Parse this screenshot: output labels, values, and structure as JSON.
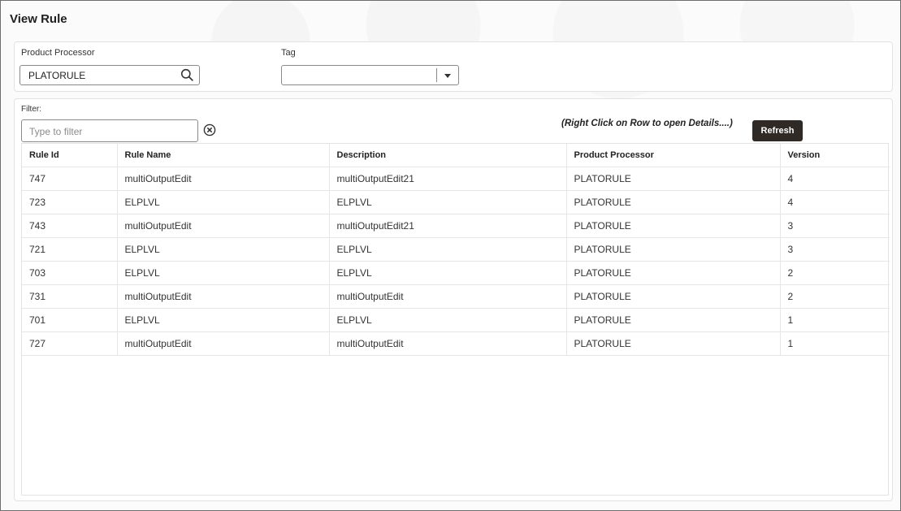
{
  "page": {
    "title": "View Rule"
  },
  "criteria": {
    "product_processor_label": "Product Processor",
    "product_processor_value": "PLATORULE",
    "tag_label": "Tag",
    "tag_value": ""
  },
  "main": {
    "filter_label": "Filter:",
    "filter_placeholder": "Type to filter",
    "hint": "(Right Click on Row to open Details....)",
    "refresh_label": "Refresh",
    "columns": [
      "Rule Id",
      "Rule Name",
      "Description",
      "Product Processor",
      "Version"
    ],
    "rows": [
      [
        "747",
        "multiOutputEdit",
        "multiOutputEdit21",
        "PLATORULE",
        "4"
      ],
      [
        "723",
        "ELPLVL",
        "ELPLVL",
        "PLATORULE",
        "4"
      ],
      [
        "743",
        "multiOutputEdit",
        "multiOutputEdit21",
        "PLATORULE",
        "3"
      ],
      [
        "721",
        "ELPLVL",
        "ELPLVL",
        "PLATORULE",
        "3"
      ],
      [
        "703",
        "ELPLVL",
        "ELPLVL",
        "PLATORULE",
        "2"
      ],
      [
        "731",
        "multiOutputEdit",
        "multiOutputEdit",
        "PLATORULE",
        "2"
      ],
      [
        "701",
        "ELPLVL",
        "ELPLVL",
        "PLATORULE",
        "1"
      ],
      [
        "727",
        "multiOutputEdit",
        "multiOutputEdit",
        "PLATORULE",
        "1"
      ]
    ]
  },
  "icons": {
    "search": "search-icon",
    "clear": "clear-circle-icon",
    "dropdown": "chevron-down-icon"
  },
  "colors": {
    "button_bg": "#2f2a26",
    "grid_border": "#e6e6e6"
  }
}
